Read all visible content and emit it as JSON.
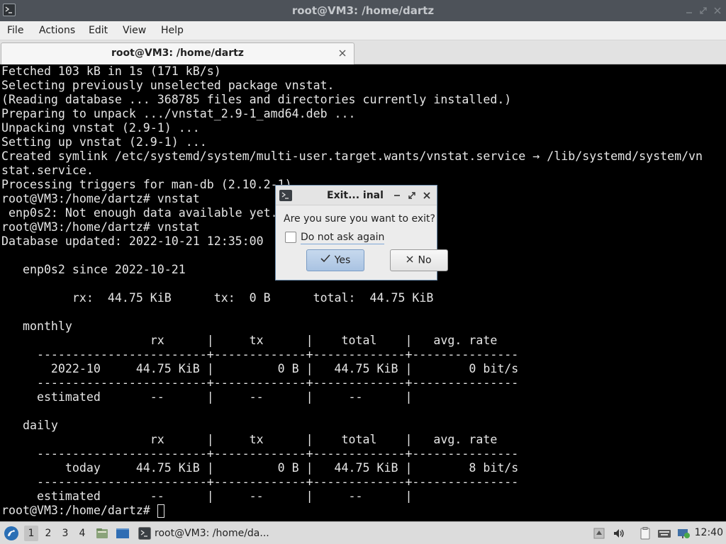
{
  "window": {
    "title": "root@VM3: /home/dartz"
  },
  "menubar": {
    "items": [
      "File",
      "Actions",
      "Edit",
      "View",
      "Help"
    ]
  },
  "tab": {
    "title": "root@VM3: /home/dartz"
  },
  "terminal": {
    "lines": [
      "Fetched 103 kB in 1s (171 kB/s)",
      "Selecting previously unselected package vnstat.",
      "(Reading database ... 368785 files and directories currently installed.)",
      "Preparing to unpack .../vnstat_2.9-1_amd64.deb ...",
      "Unpacking vnstat (2.9-1) ...",
      "Setting up vnstat (2.9-1) ...",
      "Created symlink /etc/systemd/system/multi-user.target.wants/vnstat.service → /lib/systemd/system/vn",
      "stat.service.",
      "Processing triggers for man-db (2.10.2-1) ...",
      "root@VM3:/home/dartz# vnstat",
      " enp0s2: Not enough data available yet.",
      "root@VM3:/home/dartz# vnstat",
      "Database updated: 2022-10-21 12:35:00",
      "",
      "   enp0s2 since 2022-10-21",
      "",
      "          rx:  44.75 KiB      tx:  0 B      total:  44.75 KiB",
      "",
      "   monthly",
      "                     rx      |     tx      |    total    |   avg. rate",
      "     ------------------------+-------------+-------------+---------------",
      "       2022-10     44.75 KiB |         0 B |   44.75 KiB |        0 bit/s",
      "     ------------------------+-------------+-------------+---------------",
      "     estimated       --      |     --      |     --      |",
      "",
      "   daily",
      "                     rx      |     tx      |    total    |   avg. rate",
      "     ------------------------+-------------+-------------+---------------",
      "         today     44.75 KiB |         0 B |   44.75 KiB |        8 bit/s",
      "     ------------------------+-------------+-------------+---------------",
      "     estimated       --      |     --      |     --      |",
      "root@VM3:/home/dartz# "
    ]
  },
  "dialog": {
    "title": "Exit... inal",
    "message": "Are you sure you want to exit?",
    "checkbox_label": "Do not ask again",
    "checkbox_checked": false,
    "yes_label": "Yes",
    "no_label": "No"
  },
  "taskbar": {
    "workspaces": [
      "1",
      "2",
      "3",
      "4"
    ],
    "active_workspace": "1",
    "task_label": "root@VM3: /home/da...",
    "clock": "12:40"
  },
  "colors": {
    "terminal_bg": "#000000",
    "terminal_fg": "#e6e6e6",
    "titlebar_bg": "#4d5259",
    "dialog_accent": "#a9c3e2"
  }
}
